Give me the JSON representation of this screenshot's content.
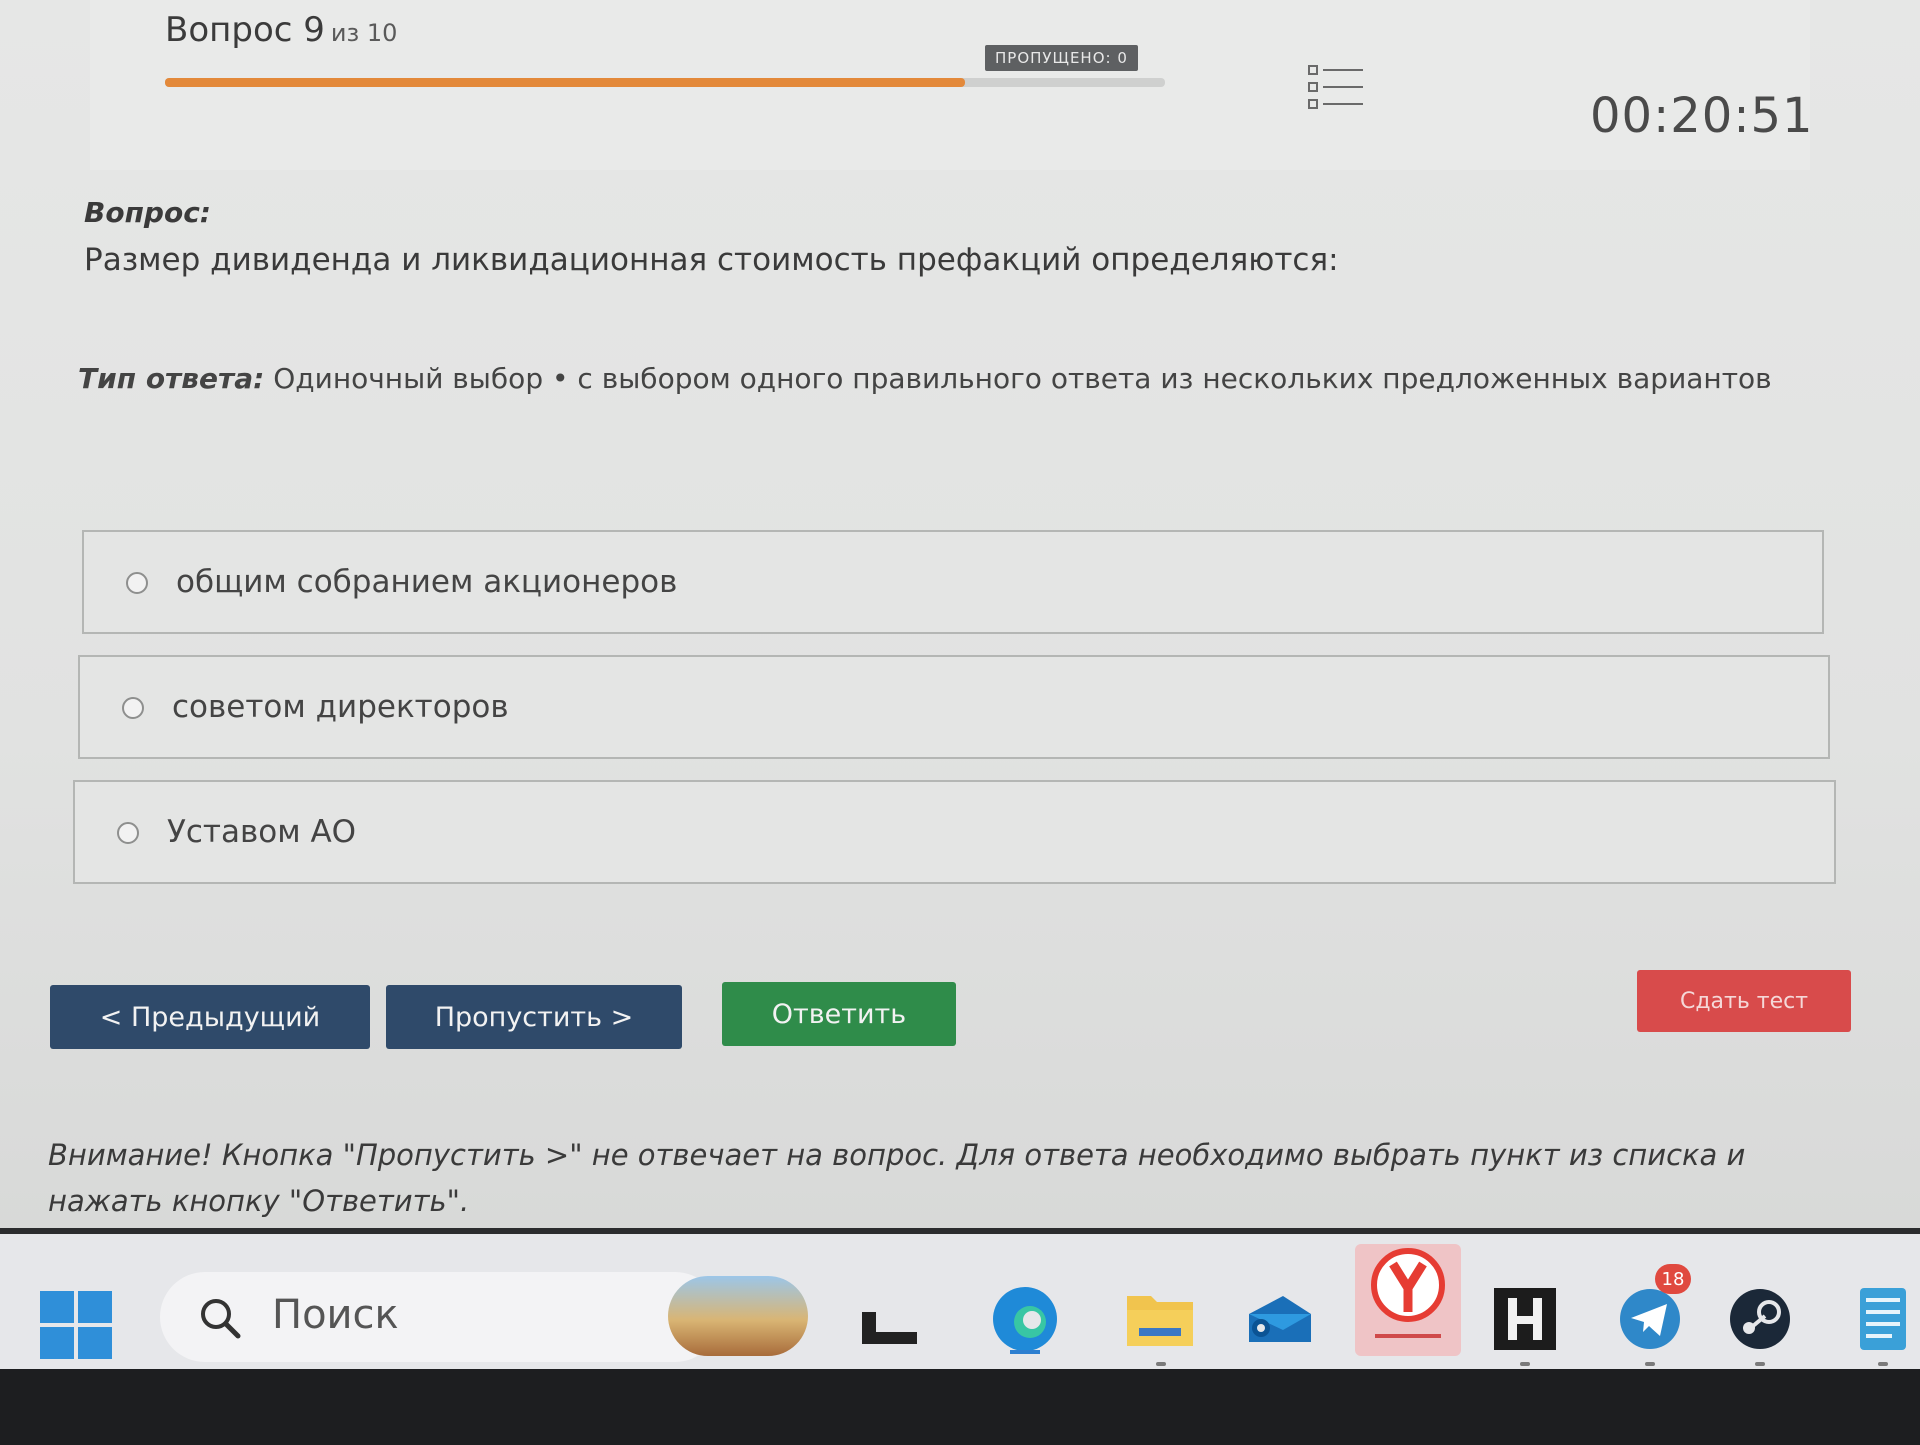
{
  "header": {
    "question_word": "Вопрос 9",
    "question_of": "из 10",
    "progress_fraction": 0.8,
    "skipped_label": "ПРОПУЩЕНО: 0",
    "timer": "00:20:51"
  },
  "question": {
    "label": "Вопрос:",
    "text": "Размер дивиденда и ликвидационная стоимость префакций определяются:",
    "answer_type_label": "Тип ответа:",
    "answer_type_text": "Одиночный выбор • с выбором одного правильного ответа из нескольких предложенных вариантов"
  },
  "options": [
    {
      "label": "общим собранием акционеров",
      "selected": false
    },
    {
      "label": "советом директоров",
      "selected": false
    },
    {
      "label": "Уставом АО",
      "selected": false
    }
  ],
  "buttons": {
    "prev": "< Предыдущий",
    "skip": "Пропустить >",
    "answer": "Ответить",
    "finish": "Сдать тест"
  },
  "warning": "Внимание! Кнопка \"Пропустить >\" не отвечает на вопрос. Для ответа необходимо выбрать пункт из списка и нажать кнопку \"Ответить\".",
  "taskbar": {
    "search_label": "Поиск",
    "telegram_badge": "18",
    "icons": [
      "windows-start-icon",
      "weather-widget-icon",
      "file-explorer-app-icon",
      "edge-browser-icon",
      "folder-icon",
      "mail-icon",
      "yandex-browser-icon",
      "h-app-icon",
      "telegram-icon",
      "steam-icon",
      "notepad-icon"
    ]
  },
  "colors": {
    "progress": "#e3893a",
    "nav_button": "#2f4a6a",
    "answer_button": "#2f8c4a",
    "finish_button": "#d84b4b"
  }
}
